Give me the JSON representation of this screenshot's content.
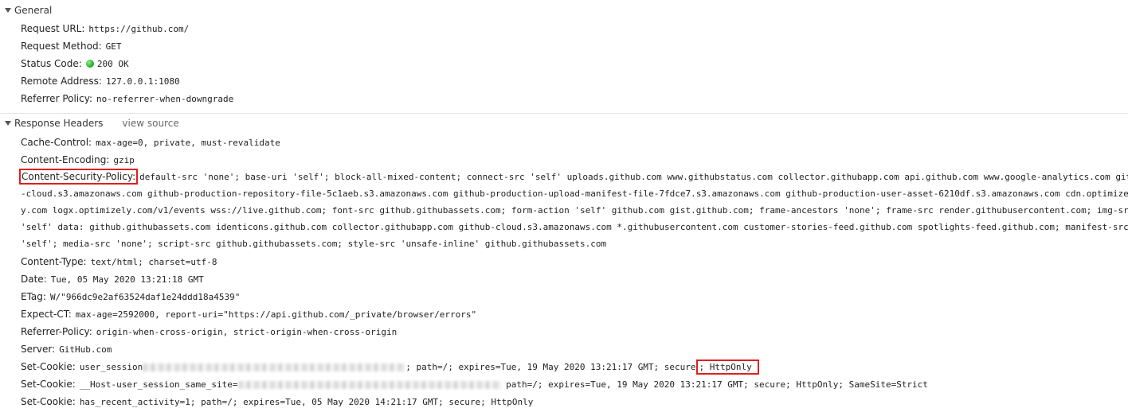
{
  "general": {
    "title": "General",
    "rows": [
      {
        "key": "Request URL:",
        "value": "https://github.com/"
      },
      {
        "key": "Request Method:",
        "value": "GET"
      },
      {
        "key": "Status Code:",
        "value": "200 OK"
      },
      {
        "key": "Remote Address:",
        "value": "127.0.0.1:1080"
      },
      {
        "key": "Referrer Policy:",
        "value": "no-referrer-when-downgrade"
      }
    ]
  },
  "response_headers": {
    "title": "Response Headers",
    "view_source": "view source",
    "cache_control": {
      "key": "Cache-Control:",
      "value": "max-age=0, private, must-revalidate"
    },
    "content_encoding": {
      "key": "Content-Encoding:",
      "value": "gzip"
    },
    "csp": {
      "key": "Content-Security-Policy:",
      "lines": [
        "default-src 'none'; base-uri 'self'; block-all-mixed-content; connect-src 'self' uploads.github.com www.githubstatus.com collector.githubapp.com api.github.com www.google-analytics.com github",
        "-cloud.s3.amazonaws.com github-production-repository-file-5c1aeb.s3.amazonaws.com github-production-upload-manifest-file-7fdce7.s3.amazonaws.com github-production-user-asset-6210df.s3.amazonaws.com cdn.optimizely.com",
        "y.com logx.optimizely.com/v1/events wss://live.github.com; font-src github.githubassets.com; form-action 'self' github.com gist.github.com; frame-ancestors 'none'; frame-src render.githubusercontent.com; img-src",
        "'self' data: github.githubassets.com identicons.github.com collector.githubapp.com github-cloud.s3.amazonaws.com *.githubusercontent.com customer-stories-feed.github.com spotlights-feed.github.com; manifest-src",
        "'self'; media-src 'none'; script-src github.githubassets.com; style-src 'unsafe-inline' github.githubassets.com"
      ]
    },
    "content_type": {
      "key": "Content-Type:",
      "value": "text/html; charset=utf-8"
    },
    "date": {
      "key": "Date:",
      "value": "Tue, 05 May 2020 13:21:18 GMT"
    },
    "etag": {
      "key": "ETag:",
      "value": "W/\"966dc9e2af63524daf1e24ddd18a4539\""
    },
    "expect_ct": {
      "key": "Expect-CT:",
      "value": "max-age=2592000, report-uri=\"https://api.github.com/_private/browser/errors\""
    },
    "referrer_policy": {
      "key": "Referrer-Policy:",
      "value": "origin-when-cross-origin, strict-origin-when-cross-origin"
    },
    "server": {
      "key": "Server:",
      "value": "GitHub.com"
    },
    "set_cookie_1": {
      "key": "Set-Cookie:",
      "prefix": "user_session",
      "suffix": "; path=/; expires=Tue, 19 May 2020 13:21:17 GMT; secure",
      "flag": "; HttpOnly"
    },
    "set_cookie_2": {
      "key": "Set-Cookie:",
      "prefix": "__Host-user_session_same_site=",
      "suffix": " path=/; expires=Tue, 19 May 2020 13:21:17 GMT; secure; HttpOnly; SameSite=Strict"
    },
    "set_cookie_3": {
      "key": "Set-Cookie:",
      "value": "has_recent_activity=1; path=/; expires=Tue, 05 May 2020 14:21:17 GMT; secure; HttpOnly"
    }
  },
  "colors": {
    "highlight_box": "#e01f1f",
    "status_ok": "#1aa51a"
  },
  "icons": {
    "collapse_toggle": "triangle-down-icon",
    "status": "green-dot-icon"
  }
}
